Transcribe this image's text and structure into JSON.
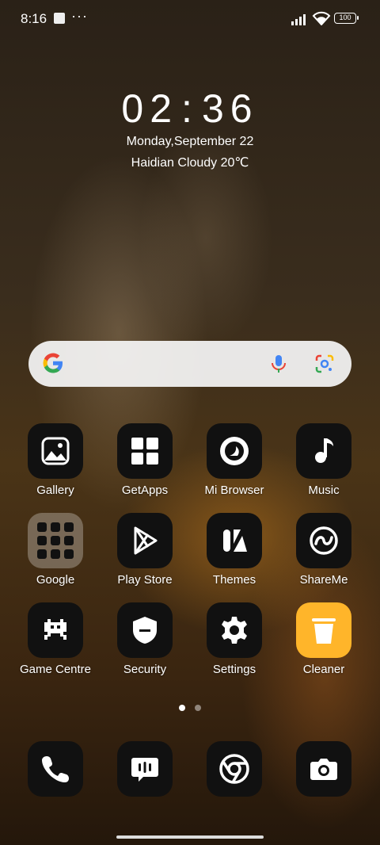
{
  "status": {
    "time": "8:16",
    "dots": "···",
    "battery": "100"
  },
  "clock": {
    "h": "02",
    "colon": ":",
    "m": "36"
  },
  "date": "Monday,September 22",
  "weather": "Haidian Cloudy 20℃",
  "apps": [
    {
      "label": "Gallery"
    },
    {
      "label": "GetApps"
    },
    {
      "label": "Mi Browser"
    },
    {
      "label": "Music"
    },
    {
      "label": "Google"
    },
    {
      "label": "Play Store"
    },
    {
      "label": "Themes"
    },
    {
      "label": "ShareMe"
    },
    {
      "label": "Game Centre"
    },
    {
      "label": "Security"
    },
    {
      "label": "Settings"
    },
    {
      "label": "Cleaner"
    }
  ],
  "pager": {
    "active_page": 1,
    "page_count": 2
  },
  "colors": {
    "cleaner_accent": "#ffb52a",
    "icon_bg": "#111111"
  }
}
